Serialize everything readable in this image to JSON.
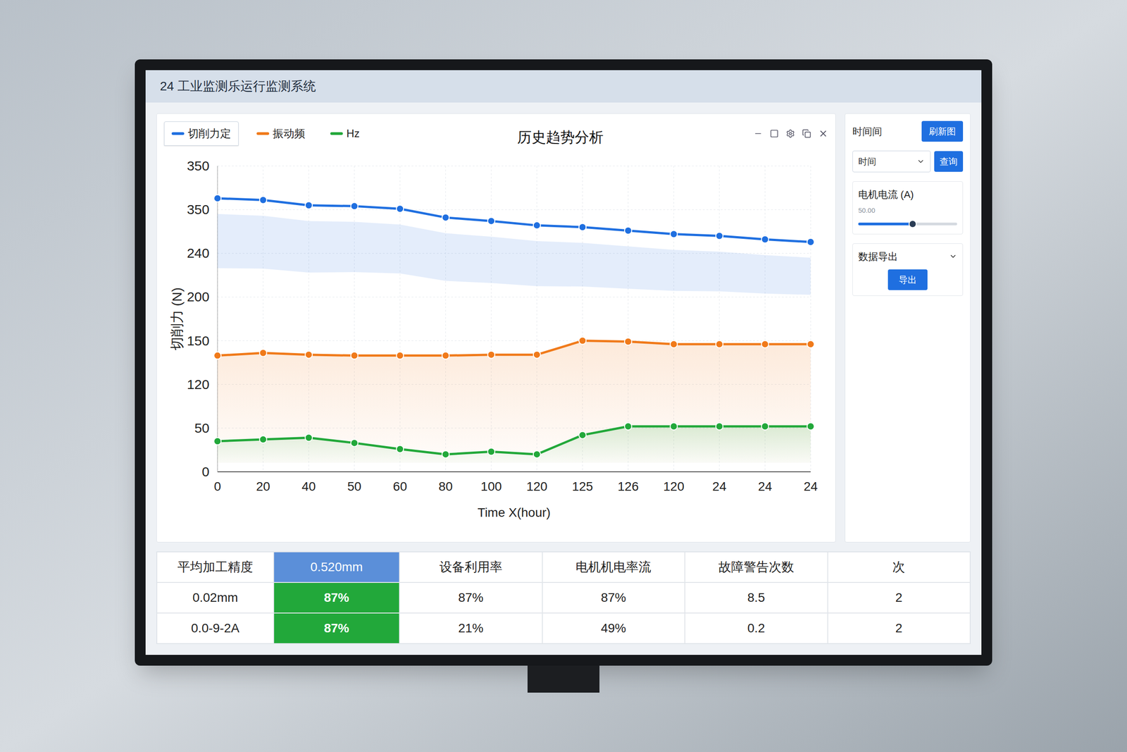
{
  "window": {
    "title": "24 工业监测乐运行监测系统"
  },
  "chart": {
    "title": "历史趋势分析",
    "y_label": "切削力 (N)",
    "y_max": 350,
    "y_ticks": [
      "350",
      "350",
      "240",
      "200",
      "150",
      "120",
      "50",
      "0"
    ],
    "x_ticks": [
      "0",
      "20",
      "40",
      "50",
      "60",
      "80",
      "100",
      "120",
      "125",
      "126",
      "120",
      "24",
      "24",
      "24"
    ],
    "x_label": "Time X(hour)",
    "series": [
      {
        "label": "切削力定",
        "selected": true,
        "color": "#1f6fe0",
        "values": [
          313,
          311,
          305,
          304,
          301,
          291,
          287,
          282,
          280,
          276,
          272,
          270,
          266,
          263
        ]
      },
      {
        "label": "振动频",
        "selected": false,
        "color": "#f07a1a",
        "values": [
          133,
          136,
          134,
          133,
          133,
          133,
          134,
          134,
          150,
          149,
          146,
          146,
          146,
          146
        ]
      },
      {
        "label": "Hz",
        "selected": false,
        "color": "#22a83a",
        "values": [
          35,
          37,
          39,
          33,
          26,
          20,
          23,
          20,
          42,
          52,
          52,
          52,
          52,
          52
        ]
      }
    ]
  },
  "side_panel": {
    "time_label": "时间间",
    "refresh_button": "刷新图",
    "time_select": "时间",
    "query_button": "查询",
    "current_label": "电机电流 (A)",
    "current_reading": "50.00",
    "current_level": 0.55,
    "export_label": "数据导出",
    "export_button": "导出"
  },
  "table": {
    "rows": [
      [
        {
          "text": "平均加工精度",
          "kind": "plain"
        },
        {
          "text": "0.520mm",
          "kind": "blue"
        },
        {
          "text": "设备利用率",
          "kind": "plain"
        },
        {
          "text": "电机机电率流",
          "kind": "plain"
        },
        {
          "text": "故障警告次数",
          "kind": "plain"
        },
        {
          "text": "次",
          "kind": "plain"
        }
      ],
      [
        {
          "text": "0.02mm",
          "kind": "plain"
        },
        {
          "text": "87%",
          "kind": "green"
        },
        {
          "text": "87%",
          "kind": "plain"
        },
        {
          "text": "87%",
          "kind": "plain"
        },
        {
          "text": "8.5",
          "kind": "plain"
        },
        {
          "text": "2",
          "kind": "plain"
        }
      ],
      [
        {
          "text": "0.0-9-2A",
          "kind": "plain"
        },
        {
          "text": "87%",
          "kind": "green"
        },
        {
          "text": "21%",
          "kind": "plain"
        },
        {
          "text": "49%",
          "kind": "plain"
        },
        {
          "text": "0.2",
          "kind": "plain"
        },
        {
          "text": "2",
          "kind": "plain"
        }
      ]
    ]
  }
}
